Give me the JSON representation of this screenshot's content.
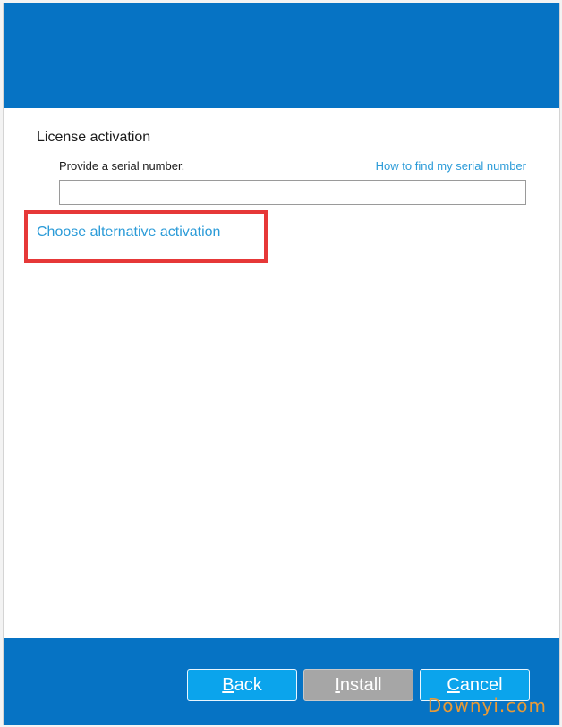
{
  "license": {
    "title": "License activation",
    "serial_label": "Provide a serial number.",
    "help_link": "How to find my serial number",
    "serial_value": "",
    "alt_activation": "Choose alternative activation"
  },
  "buttons": {
    "back": {
      "mnemonic": "B",
      "rest": "ack"
    },
    "install": {
      "mnemonic": "I",
      "rest": "nstall"
    },
    "cancel": {
      "mnemonic": "C",
      "rest": "ancel"
    }
  },
  "watermark": "Downyi.com",
  "colors": {
    "header": "#0673c4",
    "link": "#2b9bd8",
    "button_active": "#0ba4ec",
    "button_disabled": "#a6a6a6",
    "highlight": "#e63838",
    "watermark": "#e89a36"
  }
}
